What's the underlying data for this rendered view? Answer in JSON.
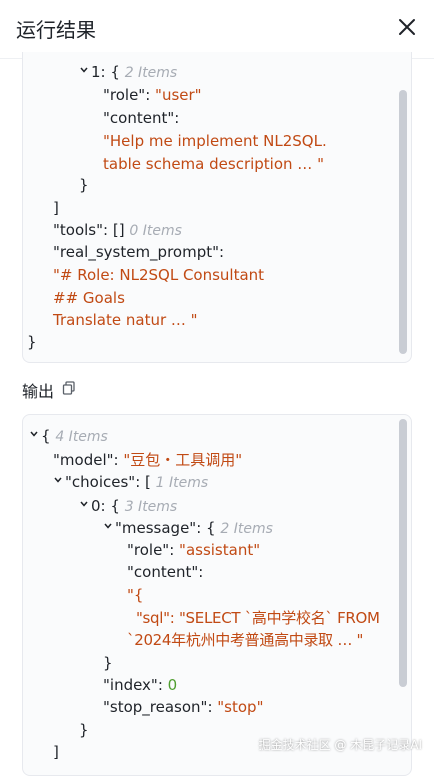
{
  "header": {
    "title": "运行结果",
    "close_icon": "close-icon"
  },
  "panel1": {
    "idx1_open": "1: {",
    "idx1_count": "2 Items",
    "role_key": "\"role\"",
    "role_val": "\"user\"",
    "content_key": "\"content\"",
    "content_l1": "\"Help me implement NL2SQL.",
    "content_l2": "table schema description … \"",
    "close_brace_inner": "}",
    "close_bracket": "]",
    "tools_key": "\"tools\"",
    "tools_val": "[]",
    "tools_count": "0 Items",
    "rsp_key": "\"real_system_prompt\"",
    "rsp_l1": "\"# Role: NL2SQL Consultant",
    "rsp_l2": "## Goals",
    "rsp_l3": "Translate natur … \"",
    "close_root": "}"
  },
  "output": {
    "label": "输出",
    "copy_icon": "copy-icon",
    "root_open": "{",
    "root_count": "4 Items",
    "model_key": "\"model\"",
    "model_val": "\"豆包・工具调用\"",
    "choices_key": "\"choices\"",
    "choices_open": "[",
    "choices_count": "1 Items",
    "idx0_open": "0: {",
    "idx0_count": "3 Items",
    "message_key": "\"message\"",
    "message_open": "{",
    "message_count": "2 Items",
    "role_key": "\"role\"",
    "role_val": "\"assistant\"",
    "content_key": "\"content\"",
    "content_l1": "\"{",
    "content_l2": "\"sql\": \"SELECT `高中学校名` FROM",
    "content_l3": "`2024年杭州中考普通高中录取 … \"",
    "msg_close": "}",
    "index_key": "\"index\"",
    "index_val": "0",
    "stop_key": "\"stop_reason\"",
    "stop_val": "\"stop\"",
    "idx0_close": "}",
    "choices_close": "]"
  },
  "watermark": "掘金技术社区 @ 木昆子记录AI"
}
